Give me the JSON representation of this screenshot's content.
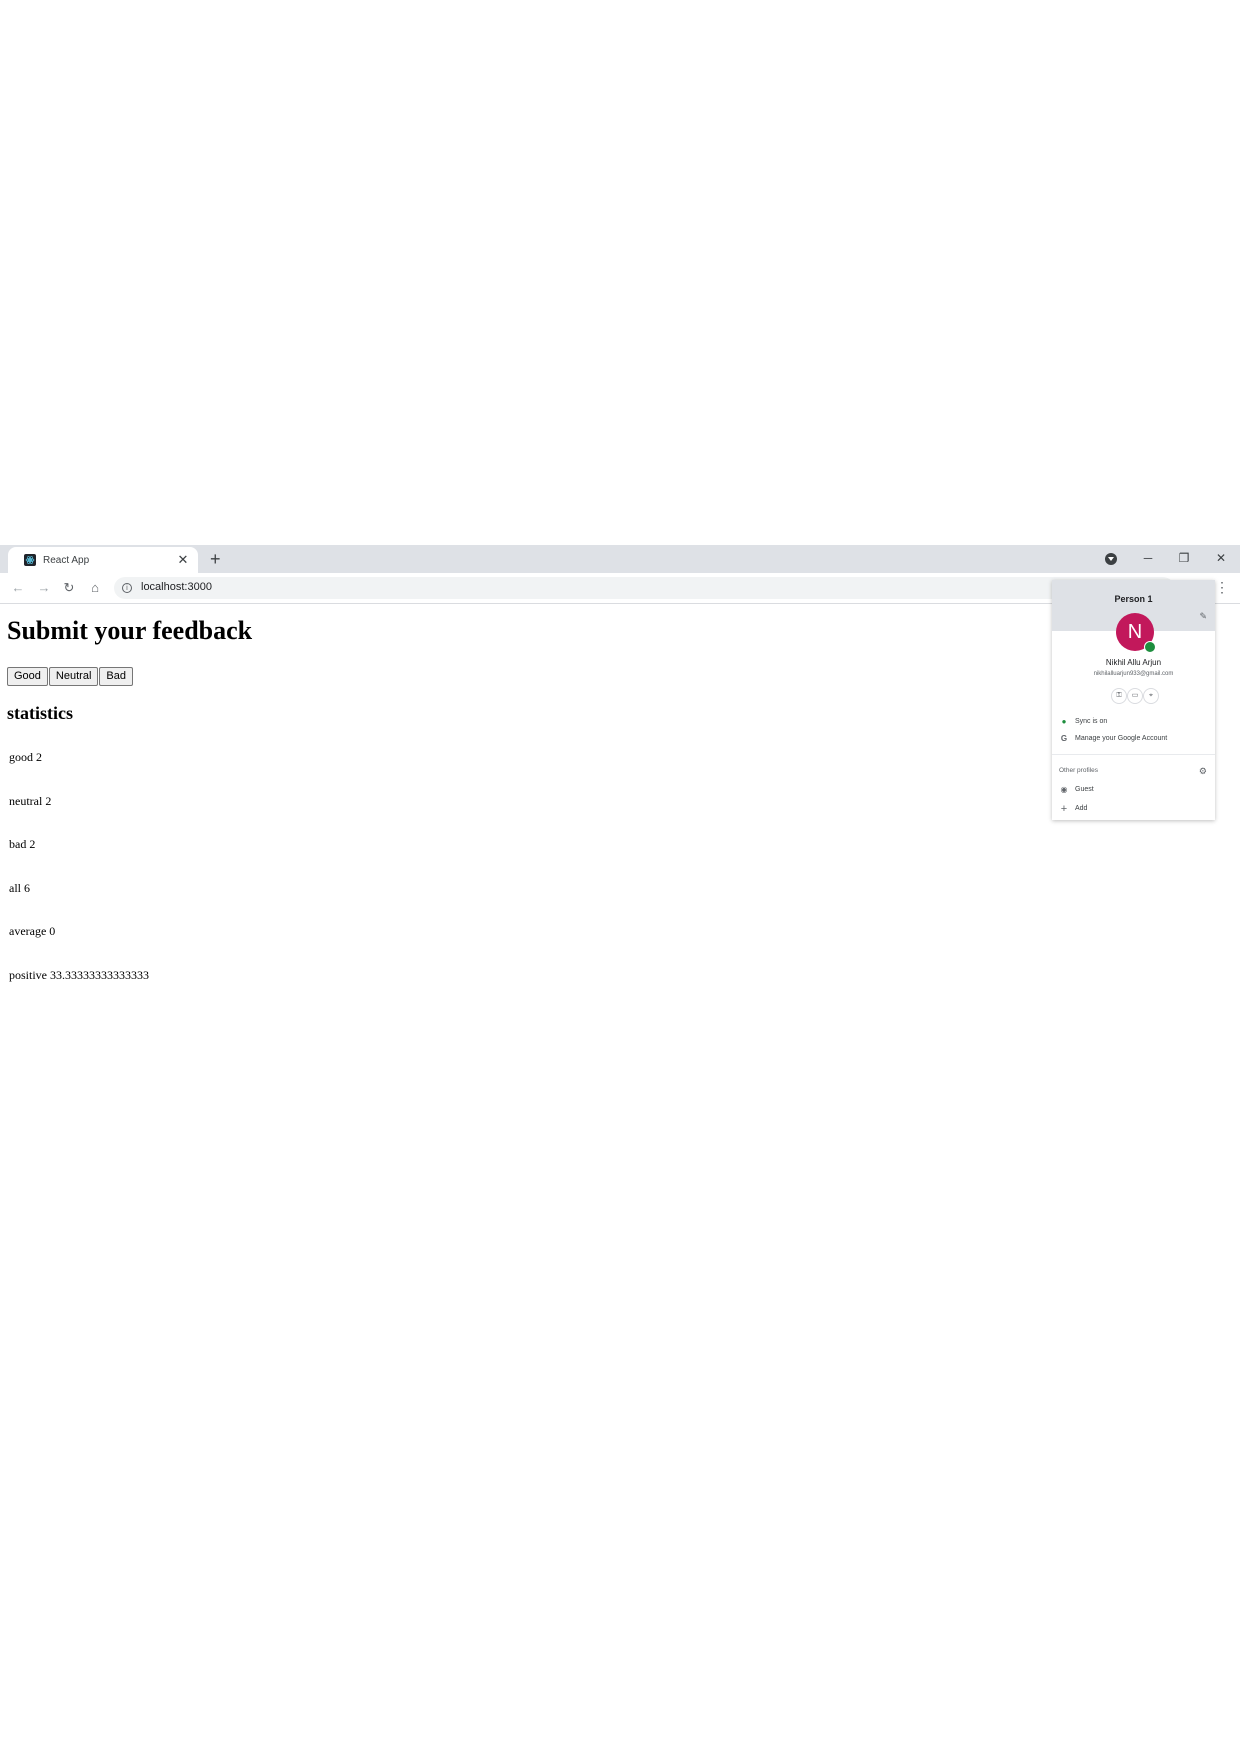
{
  "tab": {
    "title": "React App",
    "close": "✕",
    "new_tab": "+"
  },
  "window": {
    "minimize": "─",
    "maximize": "❐",
    "close": "✕"
  },
  "toolbar": {
    "url": "localhost:3000",
    "back": "←",
    "forward": "→",
    "reload": "↻",
    "home": "⌂",
    "info": "i",
    "menu": "⋮"
  },
  "page": {
    "heading": "Submit your feedback",
    "buttons": {
      "good": "Good",
      "neutral": "Neutral",
      "bad": "Bad"
    },
    "stats_heading": "statistics",
    "stats": {
      "good": "good 2",
      "neutral": "neutral 2",
      "bad": "bad 2",
      "all": "all 6",
      "average": "average 0",
      "positive": "positive 33.33333333333333"
    }
  },
  "profile_menu": {
    "title": "Person 1",
    "avatar_letter": "N",
    "name": "Nikhil Allu Arjun",
    "email": "nikhilalluarjun933@gmail.com",
    "sync": "Sync is on",
    "manage_account": "Manage your Google Account",
    "other_profiles": "Other profiles",
    "guest": "Guest",
    "add": "Add",
    "icons": {
      "key": "key-icon",
      "card": "card-icon",
      "location": "location-icon"
    }
  },
  "colors": {
    "avatar": "#c2185b",
    "sync": "#1e8e3e",
    "tabstrip": "#dee1e6"
  }
}
